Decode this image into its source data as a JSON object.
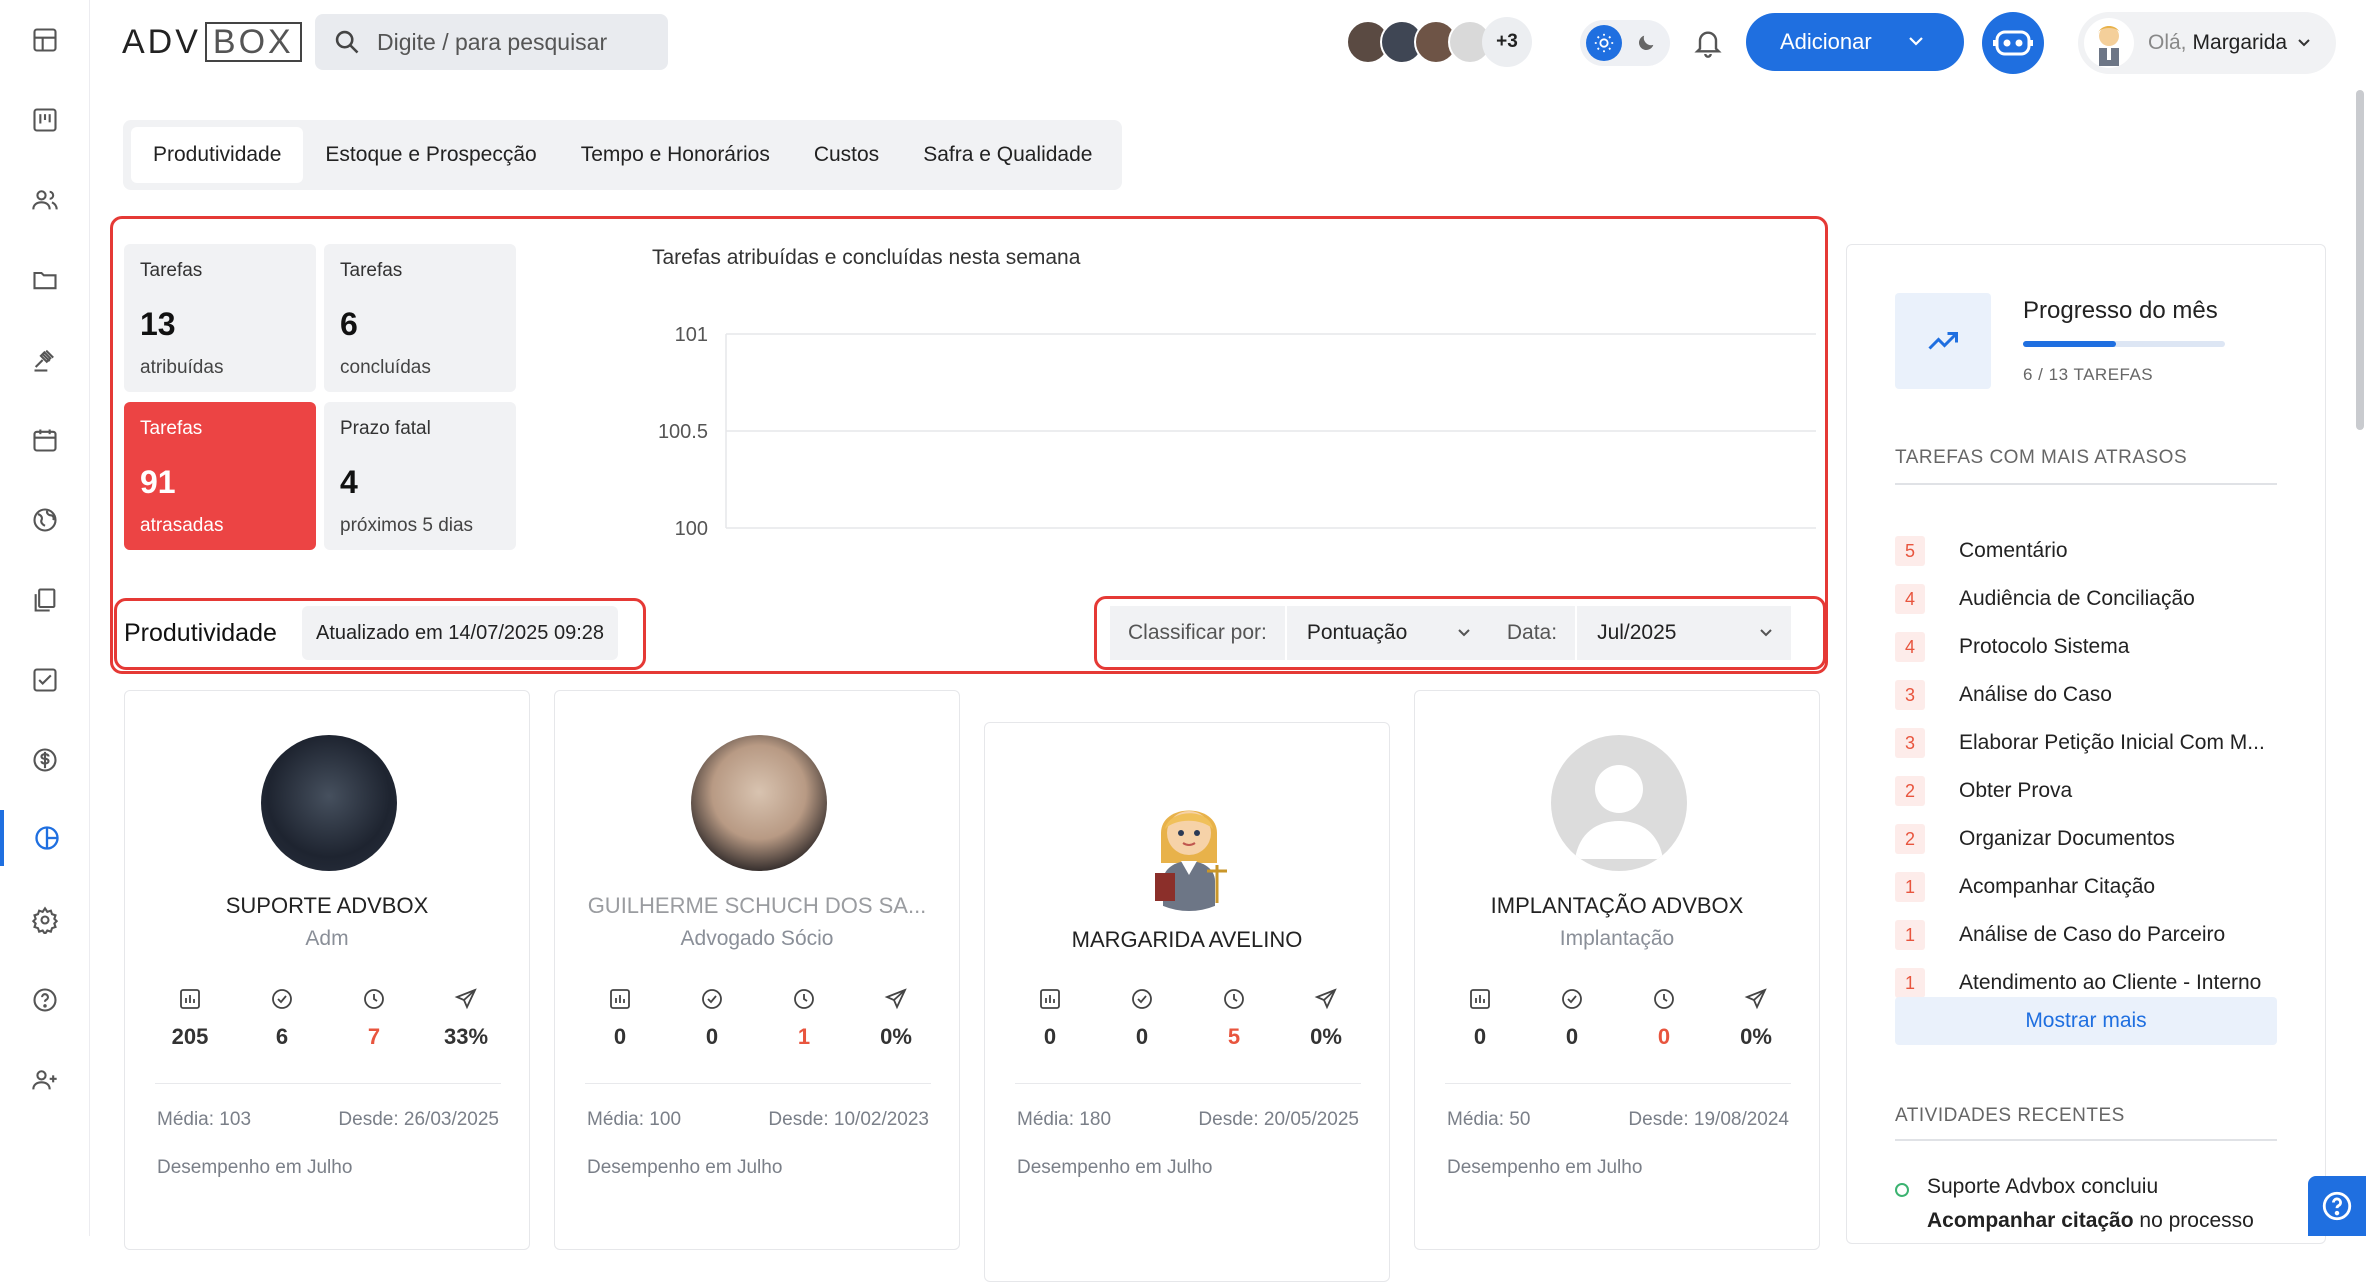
{
  "app": {
    "logo_left": "ADV",
    "logo_right": "BOX",
    "search_placeholder": "Digite / para pesquisar",
    "avatars_more": "+3",
    "add_label": "Adicionar",
    "greeting": "Olá,",
    "user_name": "Margarida"
  },
  "sidebar": [
    "dashboard-icon",
    "kanban-icon",
    "users-icon",
    "folder-icon",
    "gavel-icon",
    "calendar-icon",
    "globe-icon",
    "documents-icon",
    "checklist-icon",
    "money-icon",
    "chart-pie-icon",
    "settings-icon",
    "help-icon",
    "add-user-icon"
  ],
  "tabs": [
    "Produtividade",
    "Estoque e Prospecção",
    "Tempo e Honorários",
    "Custos",
    "Safra e Qualidade"
  ],
  "stats": [
    {
      "label": "Tarefas",
      "value": "13",
      "sub": "atribuídas"
    },
    {
      "label": "Tarefas",
      "value": "6",
      "sub": "concluídas"
    },
    {
      "label": "Tarefas",
      "value": "91",
      "sub": "atrasadas"
    },
    {
      "label": "Prazo fatal",
      "value": "4",
      "sub": "próximos 5 dias"
    }
  ],
  "chart_data": {
    "type": "line",
    "title": "Tarefas atribuídas e concluídas nesta semana",
    "y_ticks": [
      "101",
      "100.5",
      "100"
    ],
    "ylim": [
      100,
      101
    ],
    "series": [],
    "grid": true
  },
  "productivity": {
    "title": "Produtividade",
    "updated": "Atualizado em 14/07/2025 09:28",
    "sort_label": "Classificar por:",
    "sort_value": "Pontuação",
    "date_label": "Data:",
    "date_value": "Jul/2025"
  },
  "cards": [
    {
      "name": "SUPORTE ADVBOX",
      "role": "Adm",
      "metrics": [
        "205",
        "6",
        "7",
        "33%"
      ],
      "media": "Média: 103",
      "since": "Desde: 26/03/2025",
      "perf": "Desempenho em Julho"
    },
    {
      "name": "GUILHERME SCHUCH DOS SA...",
      "role": "Advogado Sócio",
      "metrics": [
        "0",
        "0",
        "1",
        "0%"
      ],
      "media": "Média: 100",
      "since": "Desde: 10/02/2023",
      "perf": "Desempenho em Julho"
    },
    {
      "name": "MARGARIDA AVELINO",
      "role": "",
      "metrics": [
        "0",
        "0",
        "5",
        "0%"
      ],
      "media": "Média: 180",
      "since": "Desde: 20/05/2025",
      "perf": "Desempenho em Julho"
    },
    {
      "name": "IMPLANTAÇÃO ADVBOX",
      "role": "Implantação",
      "metrics": [
        "0",
        "0",
        "0",
        "0%"
      ],
      "media": "Média: 50",
      "since": "Desde: 19/08/2024",
      "perf": "Desempenho em Julho"
    }
  ],
  "month_progress": {
    "title": "Progresso do mês",
    "sub": "6 / 13 TAREFAS",
    "fraction": 0.46
  },
  "late_tasks": {
    "title": "TAREFAS COM MAIS ATRASOS",
    "items": [
      {
        "count": "5",
        "label": "Comentário"
      },
      {
        "count": "4",
        "label": "Audiência de Conciliação"
      },
      {
        "count": "4",
        "label": "Protocolo Sistema"
      },
      {
        "count": "3",
        "label": "Análise do Caso"
      },
      {
        "count": "3",
        "label": "Elaborar Petição Inicial Com M..."
      },
      {
        "count": "2",
        "label": "Obter Prova"
      },
      {
        "count": "2",
        "label": "Organizar Documentos"
      },
      {
        "count": "1",
        "label": "Acompanhar Citação"
      },
      {
        "count": "1",
        "label": "Análise de Caso do Parceiro"
      },
      {
        "count": "1",
        "label": "Atendimento ao Cliente - Interno"
      }
    ],
    "more_label": "Mostrar mais"
  },
  "recent": {
    "title": "ATIVIDADES RECENTES",
    "line1": "Suporte Advbox concluiu",
    "line2_bold": "Acompanhar citação",
    "line2_rest": " no processo"
  },
  "colors": {
    "accent": "#1f6fe0",
    "danger": "#ec4444",
    "late_badge_text": "#e8553e"
  }
}
